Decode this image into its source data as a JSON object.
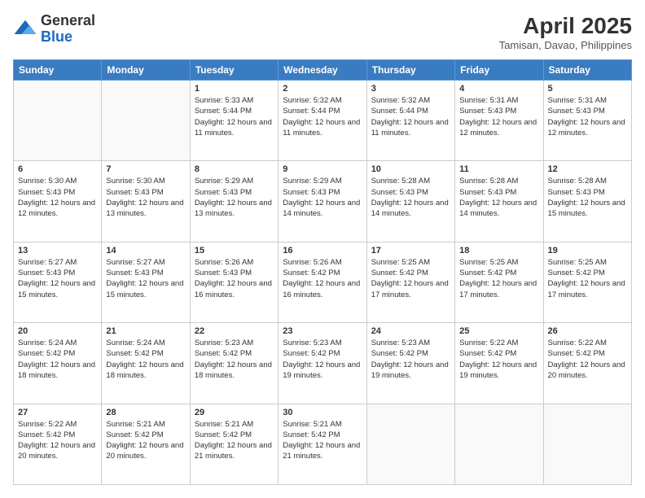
{
  "header": {
    "logo_line1": "General",
    "logo_line2": "Blue",
    "month_title": "April 2025",
    "location": "Tamisan, Davao, Philippines"
  },
  "weekdays": [
    "Sunday",
    "Monday",
    "Tuesday",
    "Wednesday",
    "Thursday",
    "Friday",
    "Saturday"
  ],
  "weeks": [
    [
      {
        "day": "",
        "content": ""
      },
      {
        "day": "",
        "content": ""
      },
      {
        "day": "1",
        "content": "Sunrise: 5:33 AM\nSunset: 5:44 PM\nDaylight: 12 hours and 11 minutes."
      },
      {
        "day": "2",
        "content": "Sunrise: 5:32 AM\nSunset: 5:44 PM\nDaylight: 12 hours and 11 minutes."
      },
      {
        "day": "3",
        "content": "Sunrise: 5:32 AM\nSunset: 5:44 PM\nDaylight: 12 hours and 11 minutes."
      },
      {
        "day": "4",
        "content": "Sunrise: 5:31 AM\nSunset: 5:43 PM\nDaylight: 12 hours and 12 minutes."
      },
      {
        "day": "5",
        "content": "Sunrise: 5:31 AM\nSunset: 5:43 PM\nDaylight: 12 hours and 12 minutes."
      }
    ],
    [
      {
        "day": "6",
        "content": "Sunrise: 5:30 AM\nSunset: 5:43 PM\nDaylight: 12 hours and 12 minutes."
      },
      {
        "day": "7",
        "content": "Sunrise: 5:30 AM\nSunset: 5:43 PM\nDaylight: 12 hours and 13 minutes."
      },
      {
        "day": "8",
        "content": "Sunrise: 5:29 AM\nSunset: 5:43 PM\nDaylight: 12 hours and 13 minutes."
      },
      {
        "day": "9",
        "content": "Sunrise: 5:29 AM\nSunset: 5:43 PM\nDaylight: 12 hours and 14 minutes."
      },
      {
        "day": "10",
        "content": "Sunrise: 5:28 AM\nSunset: 5:43 PM\nDaylight: 12 hours and 14 minutes."
      },
      {
        "day": "11",
        "content": "Sunrise: 5:28 AM\nSunset: 5:43 PM\nDaylight: 12 hours and 14 minutes."
      },
      {
        "day": "12",
        "content": "Sunrise: 5:28 AM\nSunset: 5:43 PM\nDaylight: 12 hours and 15 minutes."
      }
    ],
    [
      {
        "day": "13",
        "content": "Sunrise: 5:27 AM\nSunset: 5:43 PM\nDaylight: 12 hours and 15 minutes."
      },
      {
        "day": "14",
        "content": "Sunrise: 5:27 AM\nSunset: 5:43 PM\nDaylight: 12 hours and 15 minutes."
      },
      {
        "day": "15",
        "content": "Sunrise: 5:26 AM\nSunset: 5:43 PM\nDaylight: 12 hours and 16 minutes."
      },
      {
        "day": "16",
        "content": "Sunrise: 5:26 AM\nSunset: 5:42 PM\nDaylight: 12 hours and 16 minutes."
      },
      {
        "day": "17",
        "content": "Sunrise: 5:25 AM\nSunset: 5:42 PM\nDaylight: 12 hours and 17 minutes."
      },
      {
        "day": "18",
        "content": "Sunrise: 5:25 AM\nSunset: 5:42 PM\nDaylight: 12 hours and 17 minutes."
      },
      {
        "day": "19",
        "content": "Sunrise: 5:25 AM\nSunset: 5:42 PM\nDaylight: 12 hours and 17 minutes."
      }
    ],
    [
      {
        "day": "20",
        "content": "Sunrise: 5:24 AM\nSunset: 5:42 PM\nDaylight: 12 hours and 18 minutes."
      },
      {
        "day": "21",
        "content": "Sunrise: 5:24 AM\nSunset: 5:42 PM\nDaylight: 12 hours and 18 minutes."
      },
      {
        "day": "22",
        "content": "Sunrise: 5:23 AM\nSunset: 5:42 PM\nDaylight: 12 hours and 18 minutes."
      },
      {
        "day": "23",
        "content": "Sunrise: 5:23 AM\nSunset: 5:42 PM\nDaylight: 12 hours and 19 minutes."
      },
      {
        "day": "24",
        "content": "Sunrise: 5:23 AM\nSunset: 5:42 PM\nDaylight: 12 hours and 19 minutes."
      },
      {
        "day": "25",
        "content": "Sunrise: 5:22 AM\nSunset: 5:42 PM\nDaylight: 12 hours and 19 minutes."
      },
      {
        "day": "26",
        "content": "Sunrise: 5:22 AM\nSunset: 5:42 PM\nDaylight: 12 hours and 20 minutes."
      }
    ],
    [
      {
        "day": "27",
        "content": "Sunrise: 5:22 AM\nSunset: 5:42 PM\nDaylight: 12 hours and 20 minutes."
      },
      {
        "day": "28",
        "content": "Sunrise: 5:21 AM\nSunset: 5:42 PM\nDaylight: 12 hours and 20 minutes."
      },
      {
        "day": "29",
        "content": "Sunrise: 5:21 AM\nSunset: 5:42 PM\nDaylight: 12 hours and 21 minutes."
      },
      {
        "day": "30",
        "content": "Sunrise: 5:21 AM\nSunset: 5:42 PM\nDaylight: 12 hours and 21 minutes."
      },
      {
        "day": "",
        "content": ""
      },
      {
        "day": "",
        "content": ""
      },
      {
        "day": "",
        "content": ""
      }
    ]
  ]
}
